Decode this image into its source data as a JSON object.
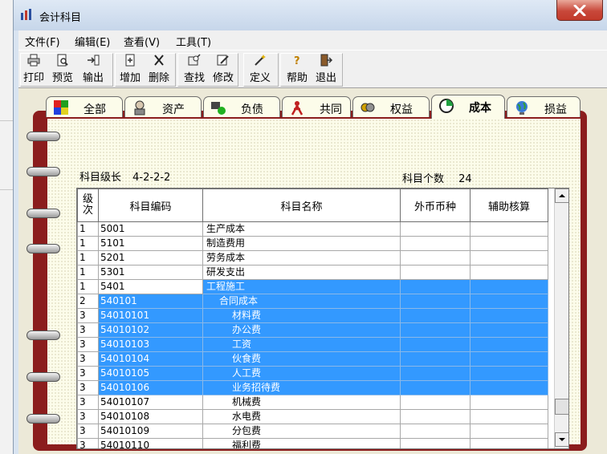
{
  "window": {
    "title": "会计科目"
  },
  "menu": [
    "文件(F)",
    "编辑(E)",
    "查看(V)",
    "工具(T)"
  ],
  "toolbar": [
    {
      "label": "打印",
      "icon": "printer-icon"
    },
    {
      "label": "预览",
      "icon": "preview-icon"
    },
    {
      "label": "输出",
      "icon": "export-icon"
    },
    {
      "label": "增加",
      "icon": "add-icon"
    },
    {
      "label": "删除",
      "icon": "delete-icon"
    },
    {
      "label": "查找",
      "icon": "find-icon"
    },
    {
      "label": "修改",
      "icon": "edit-icon"
    },
    {
      "label": "定义",
      "icon": "define-wand-icon"
    },
    {
      "label": "帮助",
      "icon": "help-icon"
    },
    {
      "label": "退出",
      "icon": "exit-icon"
    }
  ],
  "tabs": [
    {
      "label": "全部",
      "icon": "all-puzzle-icon",
      "active": false
    },
    {
      "label": "资产",
      "icon": "asset-icon",
      "active": false
    },
    {
      "label": "负债",
      "icon": "liability-icon",
      "active": false
    },
    {
      "label": "共同",
      "icon": "common-icon",
      "active": false
    },
    {
      "label": "权益",
      "icon": "equity-icon",
      "active": false
    },
    {
      "label": "成本",
      "icon": "cost-icon",
      "active": true
    },
    {
      "label": "损益",
      "icon": "profit-loss-globe-icon",
      "active": false
    }
  ],
  "info": {
    "level_label": "科目级长",
    "level_value": "4-2-2-2",
    "count_label": "科目个数",
    "count_value": "24"
  },
  "table": {
    "columns": [
      "级次",
      "科目编码",
      "科目名称",
      "外币币种",
      "辅助核算"
    ],
    "rows": [
      {
        "level": "1",
        "code": "5001",
        "name": "生产成本",
        "indent": 0,
        "selected": false
      },
      {
        "level": "1",
        "code": "5101",
        "name": "制造费用",
        "indent": 0,
        "selected": false
      },
      {
        "level": "1",
        "code": "5201",
        "name": "劳务成本",
        "indent": 0,
        "selected": false
      },
      {
        "level": "1",
        "code": "5301",
        "name": "研发支出",
        "indent": 0,
        "selected": false
      },
      {
        "level": "1",
        "code": "5401",
        "name": "工程施工",
        "indent": 0,
        "selected": true,
        "code_unselected": true
      },
      {
        "level": "2",
        "code": "540101",
        "name": "合同成本",
        "indent": 1,
        "selected": true
      },
      {
        "level": "3",
        "code": "54010101",
        "name": "材料费",
        "indent": 2,
        "selected": true
      },
      {
        "level": "3",
        "code": "54010102",
        "name": "办公费",
        "indent": 2,
        "selected": true
      },
      {
        "level": "3",
        "code": "54010103",
        "name": "工资",
        "indent": 2,
        "selected": true
      },
      {
        "level": "3",
        "code": "54010104",
        "name": "伙食费",
        "indent": 2,
        "selected": true
      },
      {
        "level": "3",
        "code": "54010105",
        "name": "人工费",
        "indent": 2,
        "selected": true
      },
      {
        "level": "3",
        "code": "54010106",
        "name": "业务招待费",
        "indent": 2,
        "selected": true
      },
      {
        "level": "3",
        "code": "54010107",
        "name": "机械费",
        "indent": 2,
        "selected": false
      },
      {
        "level": "3",
        "code": "54010108",
        "name": "水电费",
        "indent": 2,
        "selected": false
      },
      {
        "level": "3",
        "code": "54010109",
        "name": "分包费",
        "indent": 2,
        "selected": false
      },
      {
        "level": "3",
        "code": "54010110",
        "name": "福利费",
        "indent": 2,
        "selected": false
      }
    ]
  },
  "colors": {
    "selection": "#3399ff",
    "binder": "#8b1d1d",
    "close": "#c8483a"
  }
}
